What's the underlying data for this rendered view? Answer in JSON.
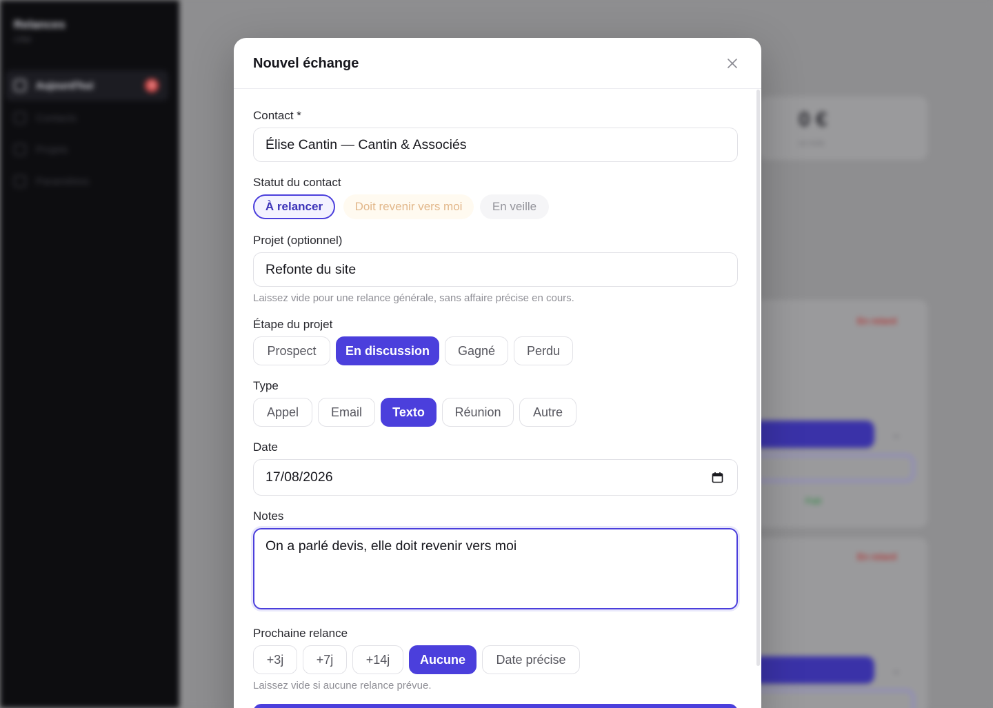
{
  "background": {
    "sidebar": {
      "title": "Relances",
      "subtitle": "CRM",
      "items": [
        {
          "label": "Aujourd'hui",
          "badge": "3"
        },
        {
          "label": "Contacts"
        },
        {
          "label": "Projets"
        },
        {
          "label": "Paramètres"
        }
      ]
    },
    "stat_value": "0 €",
    "stat_sub": "ce mois",
    "late_badge_1": "En retard",
    "late_badge_2": "En retard",
    "green_badge": "Fait"
  },
  "modal": {
    "title": "Nouvel échange",
    "close_icon": "close-icon",
    "contact": {
      "label": "Contact *",
      "value": "Élise Cantin — Cantin & Associés"
    },
    "status": {
      "label": "Statut du contact",
      "options": [
        "À relancer",
        "Doit revenir vers moi",
        "En veille"
      ],
      "selected": "À relancer"
    },
    "project": {
      "label": "Projet (optionnel)",
      "value": "Refonte du site",
      "hint": "Laissez vide pour une relance générale, sans affaire précise en cours."
    },
    "stage": {
      "label": "Étape du projet",
      "options": [
        "Prospect",
        "En discussion",
        "Gagné",
        "Perdu"
      ],
      "selected": "En discussion"
    },
    "type": {
      "label": "Type",
      "options": [
        "Appel",
        "Email",
        "Texto",
        "Réunion",
        "Autre"
      ],
      "selected": "Texto"
    },
    "date": {
      "label": "Date",
      "value": "17/08/2026",
      "icon": "calendar-icon"
    },
    "notes": {
      "label": "Notes",
      "value": "On a parlé devis, elle doit revenir vers moi"
    },
    "next_followup": {
      "label": "Prochaine relance",
      "options": [
        "+3j",
        "+7j",
        "+14j",
        "Aucune",
        "Date précise"
      ],
      "selected": "Aucune",
      "hint": "Laissez vide si aucune relance prévue."
    }
  },
  "colors": {
    "accent": "#4b3fdc",
    "sidebar_bg": "#0d0d10",
    "overlay": "#8d8d8f"
  }
}
